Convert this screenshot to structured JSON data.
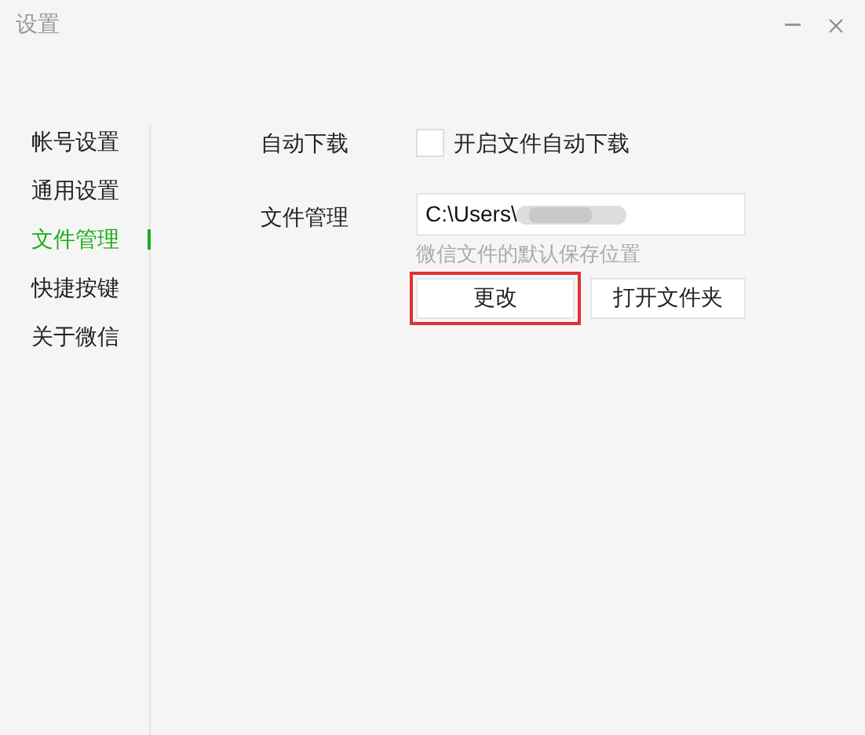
{
  "window": {
    "title": "设置"
  },
  "sidebar": {
    "items": [
      {
        "label": "帐号设置",
        "selected": false
      },
      {
        "label": "通用设置",
        "selected": false
      },
      {
        "label": "文件管理",
        "selected": true
      },
      {
        "label": "快捷按键",
        "selected": false
      },
      {
        "label": "关于微信",
        "selected": false
      }
    ]
  },
  "auto_download": {
    "label": "自动下载",
    "option": "开启文件自动下载",
    "checked": false
  },
  "file_management": {
    "label": "文件管理",
    "path": "C:\\Users\\",
    "hint": "微信文件的默认保存位置",
    "buttons": [
      {
        "label": "更改",
        "highlighted": true
      },
      {
        "label": "打开文件夹",
        "highlighted": false
      }
    ]
  }
}
